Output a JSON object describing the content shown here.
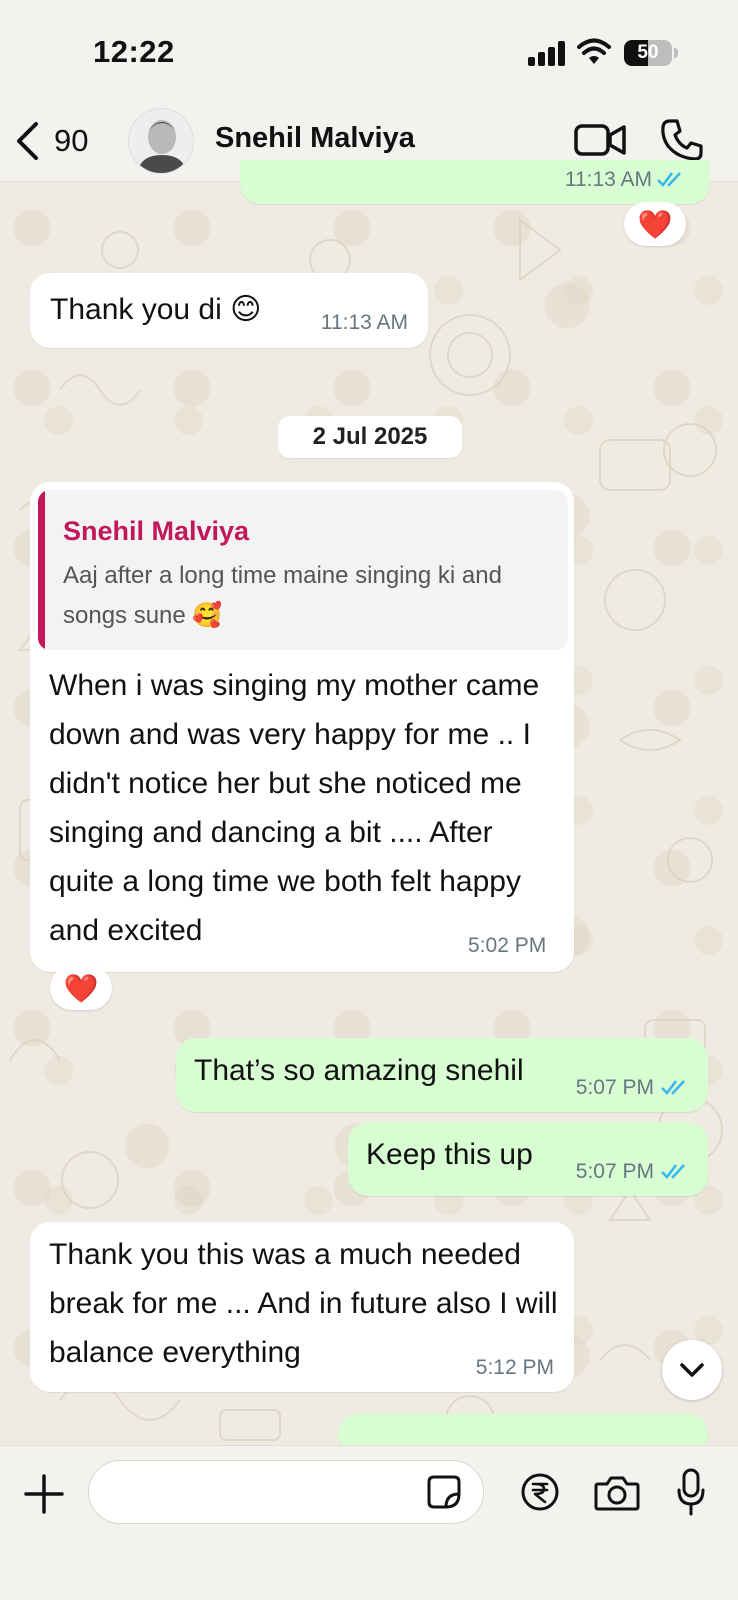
{
  "status_bar": {
    "time": "12:22",
    "battery_percent": "50",
    "battery_level": 0.5
  },
  "header": {
    "back_count": "90",
    "contact_name": "Snehil Malviya",
    "video_icon": "video-camera-icon",
    "call_icon": "phone-icon"
  },
  "messages": [
    {
      "direction": "out",
      "time": "11:13 AM",
      "reaction": "❤️"
    },
    {
      "direction": "in",
      "text": "Thank you di 😊",
      "time": "11:13 AM"
    },
    {
      "direction": "date",
      "text": "2 Jul 2025"
    },
    {
      "direction": "in",
      "quote_author": "Snehil Malviya",
      "quote_text": "Aaj after a long time maine singing ki and songs sune 🥰",
      "text": "When i was singing my mother came down and was very happy for me .. I didn't notice her but she noticed me singing and dancing a bit .... After quite a long time we both felt happy and excited",
      "time": "5:02 PM",
      "reaction": "❤️"
    },
    {
      "direction": "out",
      "text": "That’s so amazing snehil",
      "time": "5:07 PM"
    },
    {
      "direction": "out",
      "text": "Keep this up",
      "time": "5:07 PM"
    },
    {
      "direction": "in",
      "text": "Thank you this was a much needed break for me ... And in future also I will balance everything",
      "time": "5:12 PM"
    }
  ],
  "composer": {
    "placeholder": "",
    "icons": [
      "plus-icon",
      "sticker-icon",
      "rupee-icon",
      "camera-icon",
      "microphone-icon"
    ]
  },
  "colors": {
    "wallpaper": "#efeae2",
    "outgoing_bubble": "#d9fdd3",
    "incoming_bubble": "#ffffff",
    "quote_accent": "#c2185b",
    "read_ticks": "#34b7f1"
  }
}
